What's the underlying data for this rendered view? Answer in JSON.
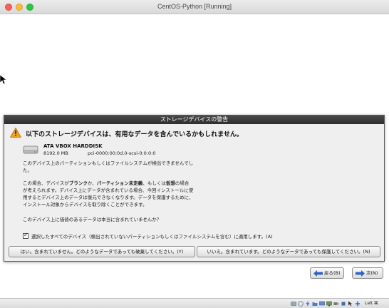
{
  "window": {
    "title": "CentOS-Python [Running]"
  },
  "dialog": {
    "title": "ストレージデバイスの警告",
    "headline": "以下のストレージデバイスは、有用なデータを含んでいるかもしれません。",
    "disk": {
      "name": "ATA VBOX HARDDISK",
      "size": "8192.0 MB",
      "id": "pci-0000:00:0d.0-scsi-0:0:0:0"
    },
    "p1": [
      "このデバイス上のパーティションもしくはファイルシステムが検出できませんでし",
      "た。"
    ],
    "p2": {
      "l1a": "この場合、デバイスが",
      "l1b": "ブランク",
      "l1c": "か、",
      "l1d": "パーティション未定義",
      "l1e": "、もしくは",
      "l1f": "仮想",
      "l1g": "の場合",
      "l2": "が考えられます。デバイス上にデータが含まれている場合、今回インストールに使",
      "l3": "用するとデバイス上のデータは復元できなくなります。データを保護するために、",
      "l4": "インストール対象からデバイスを取り除くことができます。"
    },
    "question": "このデバイス上に価値のあるデータは本当に含まれていませんか？",
    "apply_all_label": "選択したすべてのデバイス（検出されていないパーティションもしくはファイルシステムを含む）に適用します。(A)",
    "apply_all_checked": true,
    "discard_button": "はい。含まれていません。どのようなデータであっても破棄してください。(Y)",
    "keep_button": "いいえ。含まれています。どのようなデータであっても保護してください。(N)"
  },
  "nav": {
    "back": "戻る(B)",
    "next": "次(N)"
  },
  "statusbar": {
    "host_key": "Left ⌘",
    "icons": [
      "hard-disk-icon",
      "optical-drive-icon",
      "usb-icon",
      "shared-folder-icon",
      "display-icon",
      "network-icon",
      "recording-icon",
      "cpu-icon",
      "mouse-integration-icon",
      "keyboard-icon"
    ]
  },
  "colors": {
    "accent_blue": "#2e63c5",
    "warning": "#f0a020",
    "dialog_header": "#3a3a3a"
  }
}
